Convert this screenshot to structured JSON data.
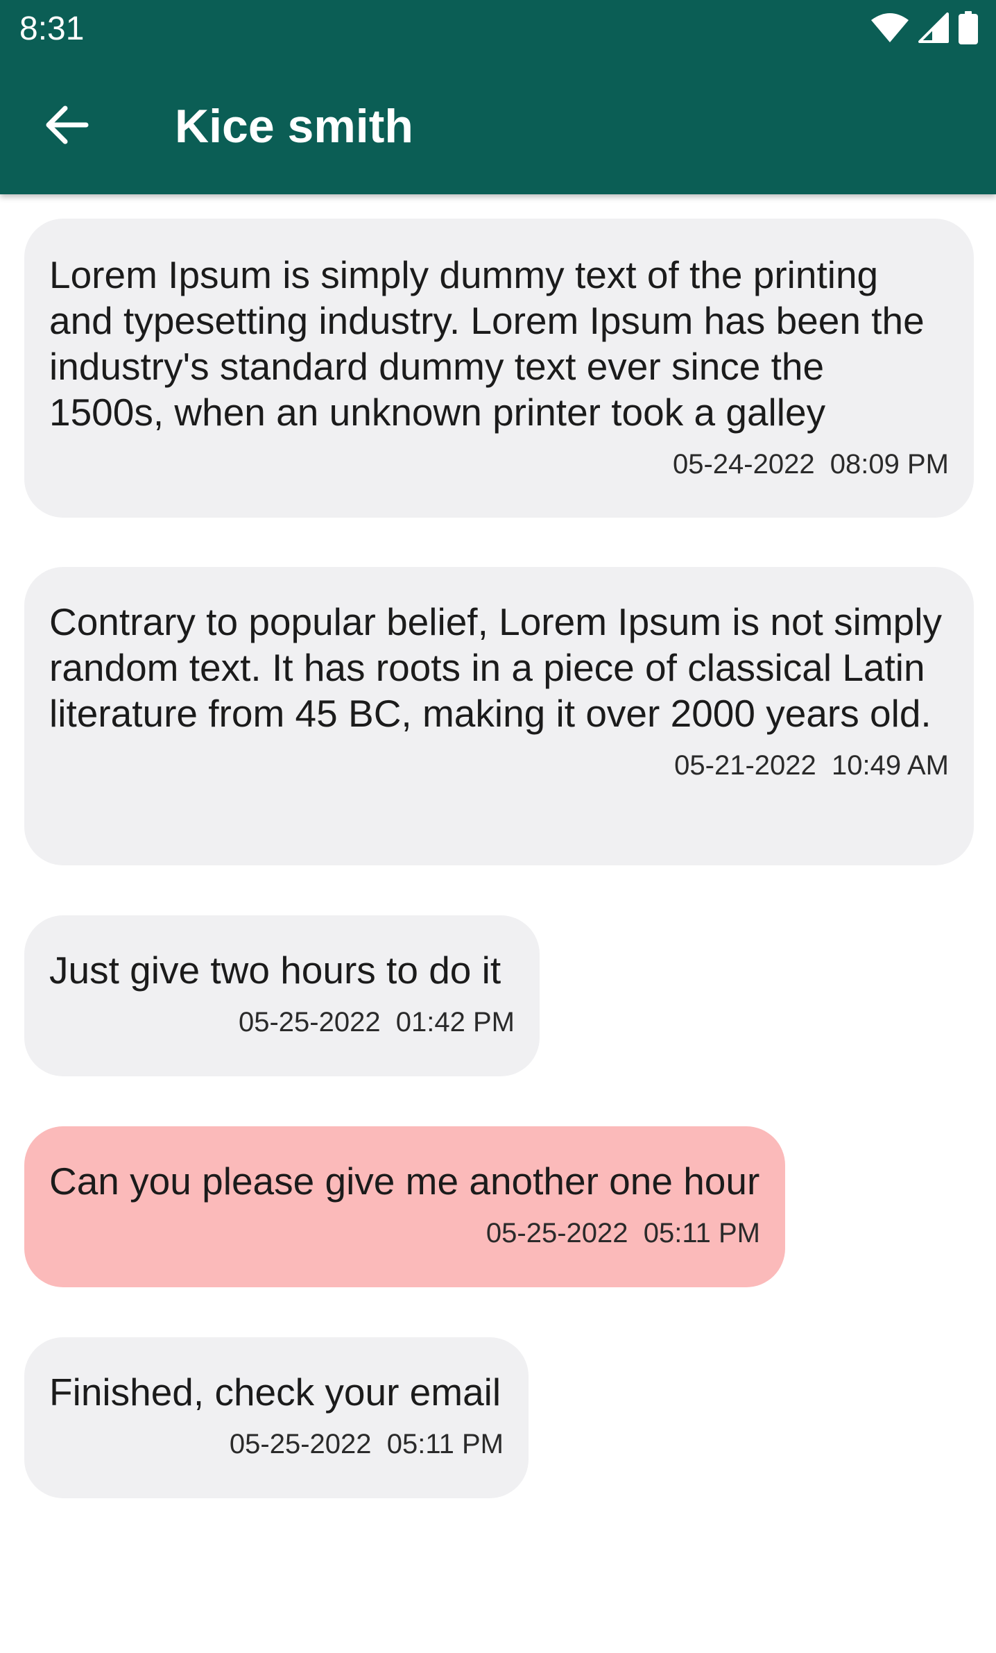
{
  "status_bar": {
    "time": "8:31",
    "icons": [
      "wifi-icon",
      "cellular-signal-icon",
      "battery-icon"
    ]
  },
  "app_bar": {
    "back_icon": "arrow-back-icon",
    "title": "Kice smith"
  },
  "colors": {
    "app_bar": "#0b5e55",
    "received_bubble": "#f0f0f2",
    "sent_bubble": "#fbbaba"
  },
  "messages": [
    {
      "text": "Lorem Ipsum is simply dummy text of the printing and typesetting industry. Lorem Ipsum has been the industry's standard dummy text ever since the 1500s, when an unknown printer took a galley",
      "date": "05-24-2022",
      "time": "08:09 PM",
      "timestamp": "05-24-2022  08:09 PM",
      "direction": "received"
    },
    {
      "text": "Contrary to popular belief, Lorem Ipsum is not simply random text. It has roots in a piece of classical Latin literature from 45 BC, making it over 2000 years old.",
      "date": "05-21-2022",
      "time": "10:49 AM",
      "timestamp": "05-21-2022  10:49 AM",
      "direction": "received"
    },
    {
      "text": "Just give two hours to do it",
      "date": "05-25-2022",
      "time": "01:42 PM",
      "timestamp": "05-25-2022  01:42 PM",
      "direction": "received"
    },
    {
      "text": "Can you please give me another one hour",
      "date": "05-25-2022",
      "time": "05:11 PM",
      "timestamp": "05-25-2022  05:11 PM",
      "direction": "sent"
    },
    {
      "text": "Finished, check your email",
      "date": "05-25-2022",
      "time": "05:11 PM",
      "timestamp": "05-25-2022  05:11 PM",
      "direction": "received"
    }
  ]
}
